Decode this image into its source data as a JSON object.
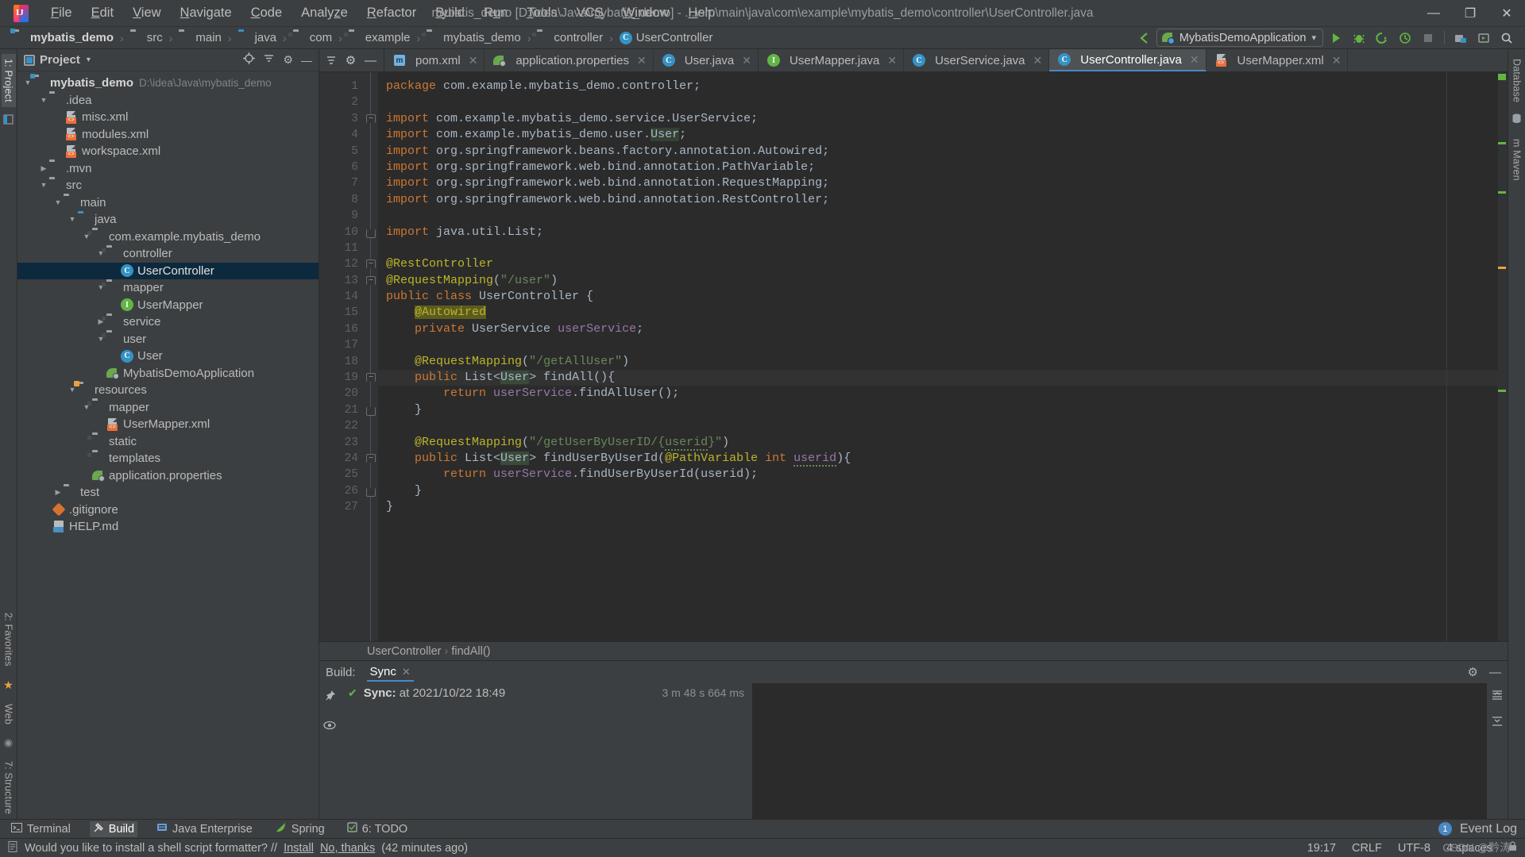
{
  "window": {
    "title": "mybatis_demo [D:\\idea\\Java\\mybatis_demo] - ...\\src\\main\\java\\com\\example\\mybatis_demo\\controller\\UserController.java",
    "minimize": "—",
    "maximize": "❐",
    "close": "✕"
  },
  "menu": [
    {
      "label": "File"
    },
    {
      "label": "Edit"
    },
    {
      "label": "View"
    },
    {
      "label": "Navigate"
    },
    {
      "label": "Code"
    },
    {
      "label": "Analyze"
    },
    {
      "label": "Refactor"
    },
    {
      "label": "Build"
    },
    {
      "label": "Run"
    },
    {
      "label": "Tools"
    },
    {
      "label": "VCS"
    },
    {
      "label": "Window"
    },
    {
      "label": "Help"
    }
  ],
  "breadcrumb": [
    {
      "label": "mybatis_demo",
      "icon": "module-folder-icon",
      "bold": true
    },
    {
      "label": "src",
      "icon": "folder-icon"
    },
    {
      "label": "main",
      "icon": "folder-icon"
    },
    {
      "label": "java",
      "icon": "source-folder-icon"
    },
    {
      "label": "com",
      "icon": "package-icon"
    },
    {
      "label": "example",
      "icon": "package-icon"
    },
    {
      "label": "mybatis_demo",
      "icon": "package-icon"
    },
    {
      "label": "controller",
      "icon": "package-icon"
    },
    {
      "label": "UserController",
      "icon": "class-icon"
    }
  ],
  "toolbar": {
    "run_config": "MybatisDemoApplication",
    "dropdown_caret": "▾",
    "buttons": [
      {
        "name": "run-button",
        "glyph": "▶"
      },
      {
        "name": "debug-button",
        "glyph": "☸"
      },
      {
        "name": "run-with-coverage-button",
        "glyph": "◖"
      },
      {
        "name": "profiler-button",
        "glyph": "◴"
      },
      {
        "name": "stop-button",
        "glyph": "■"
      },
      {
        "name": "build-project-button",
        "glyph": "⚒"
      },
      {
        "name": "update-project-button",
        "glyph": "▣"
      },
      {
        "name": "search-everywhere-button",
        "glyph": "⌕"
      }
    ]
  },
  "left_rail": [
    {
      "label": "1: Project",
      "active": true
    },
    {
      "label": "2: Favorites",
      "active": false
    }
  ],
  "right_rail": [
    {
      "label": "Database"
    },
    {
      "label": "m Maven"
    }
  ],
  "left_rail_bottom": [
    {
      "label": "Web"
    },
    {
      "label": "7: Structure"
    }
  ],
  "project_panel": {
    "title": "Project",
    "caret": "▾",
    "actions": [
      {
        "name": "locate-file-icon",
        "glyph": "⊕"
      },
      {
        "name": "collapse-all-icon",
        "glyph": "≡"
      },
      {
        "name": "settings-gear-icon",
        "glyph": "⚙"
      },
      {
        "name": "hide-panel-icon",
        "glyph": "—"
      }
    ],
    "tree": [
      {
        "depth": 0,
        "arrow": "▼",
        "label": "mybatis_demo",
        "path": "D:\\idea\\Java\\mybatis_demo",
        "icon": "module-folder-icon",
        "bold": true
      },
      {
        "depth": 1,
        "arrow": "▼",
        "label": ".idea",
        "icon": "folder-icon"
      },
      {
        "depth": 2,
        "arrow": "",
        "label": "misc.xml",
        "icon": "xml-file-icon"
      },
      {
        "depth": 2,
        "arrow": "",
        "label": "modules.xml",
        "icon": "xml-file-icon"
      },
      {
        "depth": 2,
        "arrow": "",
        "label": "workspace.xml",
        "icon": "xml-file-icon"
      },
      {
        "depth": 1,
        "arrow": "▶",
        "label": ".mvn",
        "icon": "folder-icon"
      },
      {
        "depth": 1,
        "arrow": "▼",
        "label": "src",
        "icon": "folder-icon"
      },
      {
        "depth": 2,
        "arrow": "▼",
        "label": "main",
        "icon": "folder-icon"
      },
      {
        "depth": 3,
        "arrow": "▼",
        "label": "java",
        "icon": "source-folder-icon"
      },
      {
        "depth": 4,
        "arrow": "▼",
        "label": "com.example.mybatis_demo",
        "icon": "package-icon"
      },
      {
        "depth": 5,
        "arrow": "▼",
        "label": "controller",
        "icon": "package-icon"
      },
      {
        "depth": 6,
        "arrow": "",
        "label": "UserController",
        "icon": "class-icon",
        "selected": true
      },
      {
        "depth": 5,
        "arrow": "▼",
        "label": "mapper",
        "icon": "package-icon"
      },
      {
        "depth": 6,
        "arrow": "",
        "label": "UserMapper",
        "icon": "interface-icon"
      },
      {
        "depth": 5,
        "arrow": "▶",
        "label": "service",
        "icon": "package-icon"
      },
      {
        "depth": 5,
        "arrow": "▼",
        "label": "user",
        "icon": "package-icon"
      },
      {
        "depth": 6,
        "arrow": "",
        "label": "User",
        "icon": "class-icon"
      },
      {
        "depth": 5,
        "arrow": "",
        "label": "MybatisDemoApplication",
        "icon": "spring-boot-class-icon"
      },
      {
        "depth": 3,
        "arrow": "▼",
        "label": "resources",
        "icon": "resources-folder-icon"
      },
      {
        "depth": 4,
        "arrow": "▼",
        "label": "mapper",
        "icon": "package-icon"
      },
      {
        "depth": 5,
        "arrow": "",
        "label": "UserMapper.xml",
        "icon": "xml-file-icon"
      },
      {
        "depth": 4,
        "arrow": "",
        "label": "static",
        "icon": "package-icon"
      },
      {
        "depth": 4,
        "arrow": "",
        "label": "templates",
        "icon": "package-icon"
      },
      {
        "depth": 4,
        "arrow": "",
        "label": "application.properties",
        "icon": "spring-properties-icon"
      },
      {
        "depth": 2,
        "arrow": "▶",
        "label": "test",
        "icon": "folder-icon"
      },
      {
        "depth": 1,
        "arrow": "",
        "label": ".gitignore",
        "icon": "gitignore-icon"
      },
      {
        "depth": 1,
        "arrow": "",
        "label": "HELP.md",
        "icon": "markdown-icon"
      }
    ]
  },
  "editor_tabs": [
    {
      "label": "pom.xml",
      "icon": "maven-icon",
      "active": false
    },
    {
      "label": "application.properties",
      "icon": "spring-properties-icon",
      "active": false
    },
    {
      "label": "User.java",
      "icon": "class-icon",
      "active": false
    },
    {
      "label": "UserMapper.java",
      "icon": "interface-icon",
      "active": false
    },
    {
      "label": "UserService.java",
      "icon": "class-icon",
      "active": false
    },
    {
      "label": "UserController.java",
      "icon": "class-icon",
      "active": true
    },
    {
      "label": "UserMapper.xml",
      "icon": "xml-file-icon",
      "active": false
    }
  ],
  "tab_close_glyph": "✕",
  "code": {
    "lines": [
      {
        "n": 1,
        "html": "<span class=\"kw\">package</span> com.example.mybatis_demo.controller;"
      },
      {
        "n": 2,
        "html": ""
      },
      {
        "n": 3,
        "html": "<span class=\"kw\">import</span> com.example.mybatis_demo.service.UserService;",
        "fold": "b"
      },
      {
        "n": 4,
        "html": "<span class=\"kw\">import</span> com.example.mybatis_demo.user.<span class=\"sel\">User</span>;"
      },
      {
        "n": 5,
        "html": "<span class=\"kw\">import</span> org.springframework.beans.factory.annotation.Autowired;"
      },
      {
        "n": 6,
        "html": "<span class=\"kw\">import</span> org.springframework.web.bind.annotation.PathVariable;"
      },
      {
        "n": 7,
        "html": "<span class=\"kw\">import</span> org.springframework.web.bind.annotation.RequestMapping;"
      },
      {
        "n": 8,
        "html": "<span class=\"kw\">import</span> org.springframework.web.bind.annotation.RestController;"
      },
      {
        "n": 9,
        "html": ""
      },
      {
        "n": 10,
        "html": "<span class=\"kw\">import</span> java.util.List;",
        "fold": "e"
      },
      {
        "n": 11,
        "html": ""
      },
      {
        "n": 12,
        "html": "<span class=\"ann\">@RestController</span>",
        "fold": "b"
      },
      {
        "n": 13,
        "html": "<span class=\"ann\">@RequestMapping</span>(<span class=\"str\">\"/user\"</span>)",
        "fold": "b"
      },
      {
        "n": 14,
        "html": "<span class=\"kw\">public class</span> UserController {",
        "gmark": "bean-class-icon"
      },
      {
        "n": 15,
        "html": "    <span class=\"ann hlann\">@Autowired</span>"
      },
      {
        "n": 16,
        "html": "    <span class=\"kw\">private</span> UserService <span class=\"fld2\">userService</span>;",
        "gmark": "bean-autowired-icon"
      },
      {
        "n": 17,
        "html": ""
      },
      {
        "n": 18,
        "html": "    <span class=\"ann\">@RequestMapping</span>(<span class=\"str\">\"/getAllUser\"</span>)",
        "gmark": "intention-bulb-icon"
      },
      {
        "n": 19,
        "html": "    <span class=\"kw\">public</span> List&lt;<span class=\"selw\">User</span>&gt; findAll(){",
        "fold": "b",
        "hl": true
      },
      {
        "n": 20,
        "html": "        <span class=\"kw2\">return</span> <span class=\"fld2\">userService</span>.findAllUser();"
      },
      {
        "n": 21,
        "html": "    }",
        "fold": "e"
      },
      {
        "n": 22,
        "html": ""
      },
      {
        "n": 23,
        "html": "    <span class=\"ann\">@RequestMapping</span>(<span class=\"str\">\"/getUserByUserID/{</span><span class=\"str wavy\">userid</span><span class=\"str\">}\"</span>)"
      },
      {
        "n": 24,
        "html": "    <span class=\"kw\">public</span> List&lt;<span class=\"selw\">User</span>&gt; findUserByUserId(<span class=\"ann\">@PathVariable</span> <span class=\"kw\">int</span> <span class=\"fld2 wavy\">userid</span>){",
        "fold": "b"
      },
      {
        "n": 25,
        "html": "        <span class=\"kw2\">return</span> <span class=\"fld2\">userService</span>.findUserByUserId(userid);"
      },
      {
        "n": 26,
        "html": "    }",
        "fold": "e"
      },
      {
        "n": 27,
        "html": "}"
      }
    ],
    "breadcrumb": [
      "UserController",
      "findAll()"
    ],
    "breadcrumb_sep": "›"
  },
  "build_panel": {
    "label": "Build:",
    "tab": "Sync",
    "tab_close": "✕",
    "row": {
      "check": "✔",
      "title": "Sync:",
      "detail": "at 2021/10/22 18:49",
      "duration": "3 m 48 s 664 ms"
    },
    "actions": [
      {
        "name": "pin-icon",
        "glyph": "📌"
      },
      {
        "name": "eye-icon",
        "glyph": "◉"
      },
      {
        "name": "settings-gear-icon",
        "glyph": "⚙"
      },
      {
        "name": "hide-build-panel-icon",
        "glyph": "—"
      },
      {
        "name": "expand-all-icon",
        "glyph": "≣"
      },
      {
        "name": "collapse-all-icon",
        "glyph": "≢"
      }
    ]
  },
  "tool_window_bar": [
    {
      "label": "Terminal",
      "icon": "terminal-icon",
      "active": false
    },
    {
      "label": "Build",
      "icon": "build-hammer-icon",
      "active": true
    },
    {
      "label": "Java Enterprise",
      "icon": "java-enterprise-icon",
      "active": false
    },
    {
      "label": "Spring",
      "icon": "spring-leaf-icon",
      "active": false
    },
    {
      "label": "6: TODO",
      "icon": "todo-icon",
      "active": false
    }
  ],
  "event_log": {
    "count": "1",
    "label": "Event Log"
  },
  "status_bar": {
    "message_prefix": "Would you like to install a shell script formatter? //",
    "install_link": "Install",
    "decline_link": "No, thanks",
    "message_suffix": "(42 minutes ago)",
    "time": "19:17",
    "line_separator": "CRLF",
    "encoding": "UTF-8",
    "indent": "4 spaces",
    "watermark": "CSDN @黔涛"
  },
  "colors": {
    "accent": "#4a88c7",
    "selection": "#0d293e",
    "keyword": "#cc7832",
    "string": "#6a8759",
    "annotation": "#bbb529",
    "field": "#9876aa",
    "editor_bg": "#2b2b2b",
    "chrome_bg": "#3c3f41"
  }
}
